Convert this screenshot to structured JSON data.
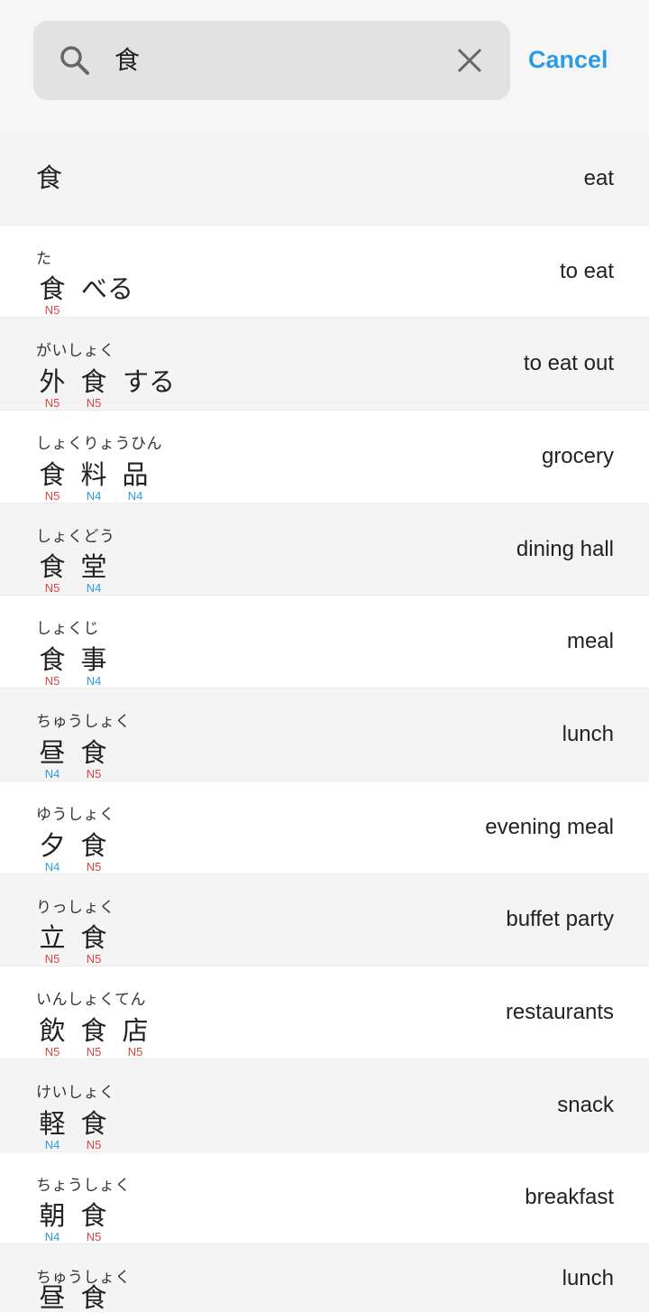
{
  "search": {
    "query": "食",
    "cancel_label": "Cancel"
  },
  "results": [
    {
      "single": "食",
      "meaning": "eat"
    },
    {
      "reading": "た",
      "units": [
        {
          "k": "食",
          "lv": "N5"
        }
      ],
      "kana": "べる",
      "meaning": "to eat"
    },
    {
      "reading": "がいしょく",
      "units": [
        {
          "k": "外",
          "lv": "N5"
        },
        {
          "k": "食",
          "lv": "N5"
        }
      ],
      "kana": "する",
      "meaning": "to eat out"
    },
    {
      "reading": "しょくりょうひん",
      "units": [
        {
          "k": "食",
          "lv": "N5"
        },
        {
          "k": "料",
          "lv": "N4"
        },
        {
          "k": "品",
          "lv": "N4"
        }
      ],
      "meaning": "grocery"
    },
    {
      "reading": "しょくどう",
      "units": [
        {
          "k": "食",
          "lv": "N5"
        },
        {
          "k": "堂",
          "lv": "N4"
        }
      ],
      "meaning": "dining hall"
    },
    {
      "reading": "しょくじ",
      "units": [
        {
          "k": "食",
          "lv": "N5"
        },
        {
          "k": "事",
          "lv": "N4"
        }
      ],
      "meaning": "meal"
    },
    {
      "reading": "ちゅうしょく",
      "units": [
        {
          "k": "昼",
          "lv": "N4"
        },
        {
          "k": "食",
          "lv": "N5"
        }
      ],
      "meaning": "lunch"
    },
    {
      "reading": "ゆうしょく",
      "units": [
        {
          "k": "夕",
          "lv": "N4"
        },
        {
          "k": "食",
          "lv": "N5"
        }
      ],
      "meaning": "evening meal"
    },
    {
      "reading": "りっしょく",
      "units": [
        {
          "k": "立",
          "lv": "N5"
        },
        {
          "k": "食",
          "lv": "N5"
        }
      ],
      "meaning": "buffet party"
    },
    {
      "reading": "いんしょくてん",
      "units": [
        {
          "k": "飲",
          "lv": "N5"
        },
        {
          "k": "食",
          "lv": "N5"
        },
        {
          "k": "店",
          "lv": "N5"
        }
      ],
      "meaning": "restaurants"
    },
    {
      "reading": "けいしょく",
      "units": [
        {
          "k": "軽",
          "lv": "N4"
        },
        {
          "k": "食",
          "lv": "N5"
        }
      ],
      "meaning": "snack"
    },
    {
      "reading": "ちょうしょく",
      "units": [
        {
          "k": "朝",
          "lv": "N4"
        },
        {
          "k": "食",
          "lv": "N5"
        }
      ],
      "meaning": "breakfast"
    },
    {
      "reading": "ちゅうしょく",
      "units": [
        {
          "k": "昼",
          "lv": ""
        },
        {
          "k": "食",
          "lv": ""
        }
      ],
      "meaning": "lunch"
    }
  ],
  "colors": {
    "accent": "#2b9be5",
    "n5": "#d9453d",
    "n4": "#2b9be5"
  },
  "icons": {
    "search": "search-icon",
    "clear": "close-icon"
  }
}
